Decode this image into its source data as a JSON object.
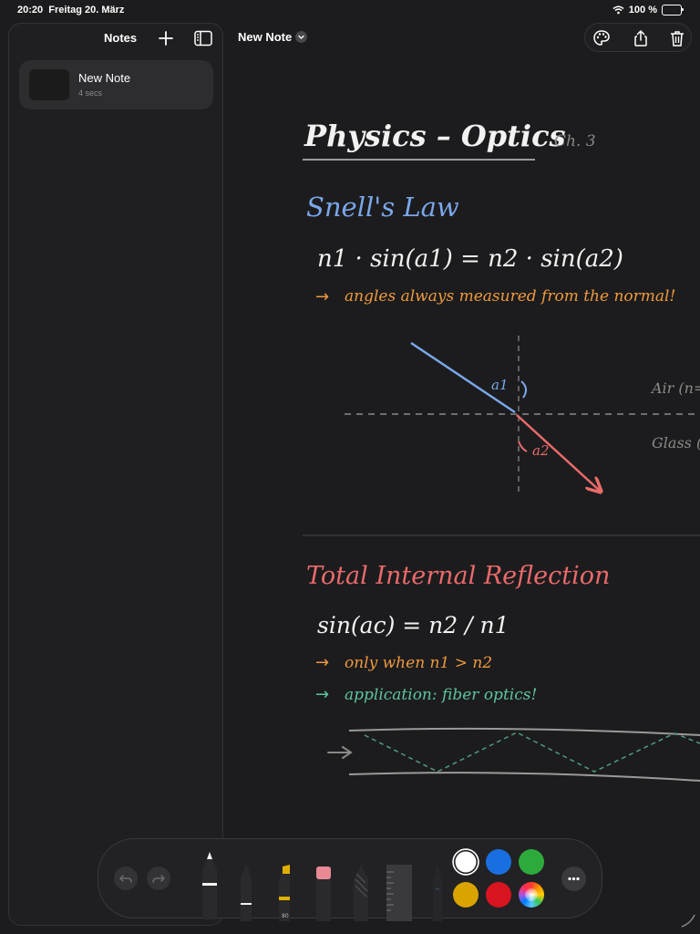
{
  "status_bar": {
    "time": "20:20",
    "date": "Freitag 20. März",
    "battery": "100 %",
    "battery_level": 1.0
  },
  "sidebar": {
    "title": "Notes",
    "notes": [
      {
        "title": "New Note",
        "time": "4 secs"
      }
    ]
  },
  "header": {
    "title": "New Note"
  },
  "icons": {
    "add": "plus-icon",
    "sidebar_toggle": "sidebar-toggle-icon",
    "title_menu": "chevron-down-icon",
    "palette": "palette-icon",
    "share": "share-icon",
    "delete": "trash-icon",
    "undo": "undo-icon",
    "redo": "redo-icon",
    "more": "more-icon"
  },
  "note": {
    "title": "Physics – Optics",
    "chapter": "Ch. 3",
    "section1": {
      "heading": "Snell's Law",
      "formula": "n1 · sin(a1) = n2 · sin(a2)",
      "note": "angles always measured from the normal!",
      "diagram": {
        "angle1": "a1",
        "angle2": "a2",
        "medium1": "Air (n=",
        "medium2": "Glass ("
      }
    },
    "section2": {
      "heading": "Total Internal Reflection",
      "formula": "sin(ac) = n2 / n1",
      "note1": "only when n1 > n2",
      "note2": "application: fiber optics!"
    }
  },
  "toolbar": {
    "tools": [
      "pen",
      "fineliner",
      "highlighter",
      "eraser",
      "pencil",
      "ruler",
      "lasso"
    ],
    "highlighter_value": "80",
    "colors": [
      "#ffffff",
      "#1a6fe0",
      "#2eaa3c",
      "#d9a300",
      "#d7141f"
    ],
    "selected_color": "#ffffff"
  },
  "palette": {
    "blue": "#7ba7ea",
    "red": "#ea6a6a",
    "orange": "#ee9a3e",
    "green": "#5ec4a0",
    "white": "#f2f2f2",
    "gray": "#8a8a8a"
  }
}
